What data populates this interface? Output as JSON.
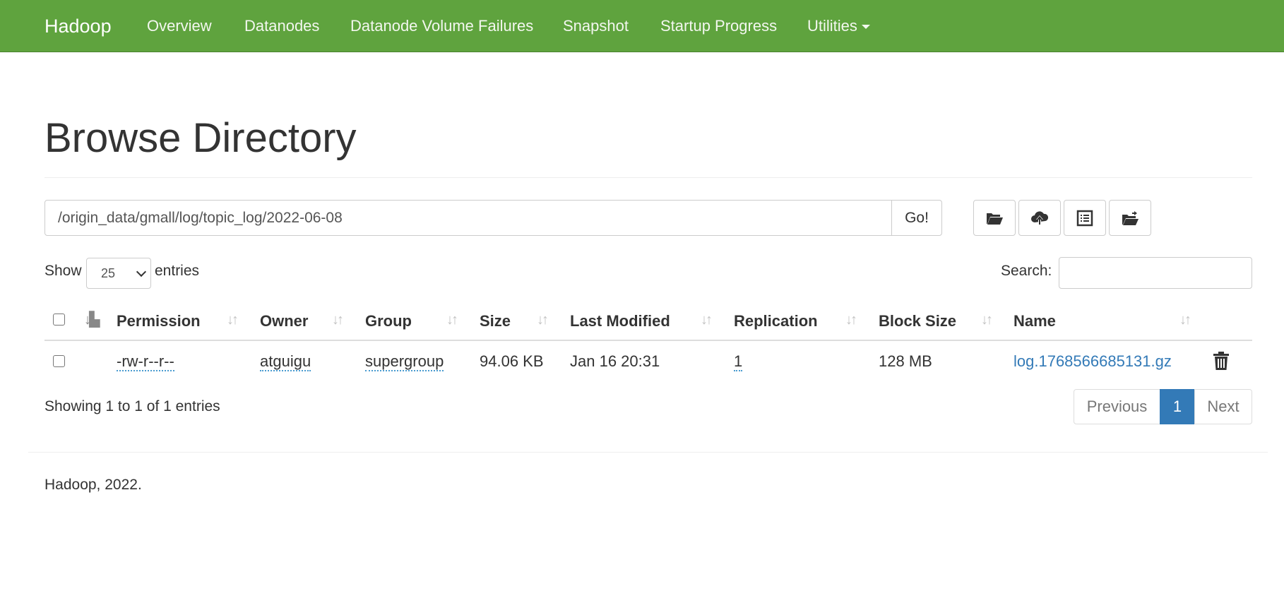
{
  "navbar": {
    "brand": "Hadoop",
    "items": [
      {
        "label": "Overview"
      },
      {
        "label": "Datanodes"
      },
      {
        "label": "Datanode Volume Failures"
      },
      {
        "label": "Snapshot"
      },
      {
        "label": "Startup Progress"
      },
      {
        "label": "Utilities"
      }
    ]
  },
  "page": {
    "title": "Browse Directory"
  },
  "path_bar": {
    "value": "/origin_data/gmall/log/topic_log/2022-06-08",
    "go_label": "Go!",
    "tools": [
      "folder-open-icon",
      "cloud-upload-icon",
      "list-alt-icon",
      "folder-move-icon"
    ]
  },
  "controls": {
    "show_label": "Show",
    "entries_value": "25",
    "entries_label": "entries",
    "search_label": "Search:"
  },
  "table": {
    "columns": [
      "Permission",
      "Owner",
      "Group",
      "Size",
      "Last Modified",
      "Replication",
      "Block Size",
      "Name"
    ],
    "rows": [
      {
        "permission": "-rw-r--r--",
        "owner": "atguigu",
        "group": "supergroup",
        "size": "94.06 KB",
        "last_modified": "Jan 16 20:31",
        "replication": "1",
        "block_size": "128 MB",
        "name": "log.1768566685131.gz"
      }
    ]
  },
  "footer_info": {
    "showing": "Showing 1 to 1 of 1 entries"
  },
  "pagination": {
    "previous": "Previous",
    "current": "1",
    "next": "Next"
  },
  "footer": {
    "text": "Hadoop, 2022."
  },
  "colors": {
    "navbar": "#5fa33e",
    "link": "#337ab7",
    "active_page": "#337ab7"
  }
}
